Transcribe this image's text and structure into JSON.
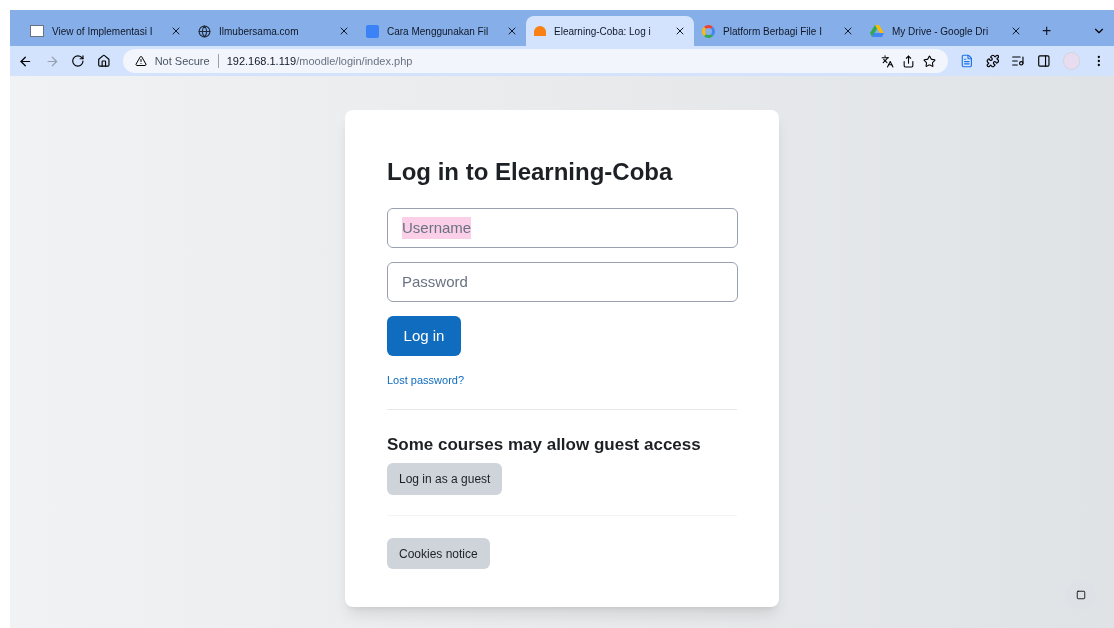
{
  "tabs": [
    {
      "title": "View of Implementasi I",
      "kind": "pdf",
      "selected": false
    },
    {
      "title": "Ilmubersama.com",
      "kind": "globe",
      "selected": false
    },
    {
      "title": "Cara Menggunakan Fil",
      "kind": "square",
      "selected": false
    },
    {
      "title": "Elearning-Coba: Log i",
      "kind": "moodle",
      "selected": true
    },
    {
      "title": "Platform Berbagi File I",
      "kind": "google",
      "selected": false
    },
    {
      "title": "My Drive - Google Dri",
      "kind": "drive",
      "selected": false
    }
  ],
  "new_tab": "+",
  "address_bar": {
    "security": "Not Secure",
    "url_host": "192.168.1.119",
    "url_path": "/moodle/login/index.php"
  },
  "login": {
    "title": "Log in to Elearning-Coba",
    "fields": [
      {
        "placeholder": "Username",
        "highlighted": true
      },
      {
        "placeholder": "Password",
        "highlighted": false
      }
    ],
    "submit": "Log in",
    "lost_password": "Lost password?",
    "guest_heading": "Some courses may allow guest access",
    "guest_button": "Log in as a guest",
    "cookies_button": "Cookies notice"
  }
}
